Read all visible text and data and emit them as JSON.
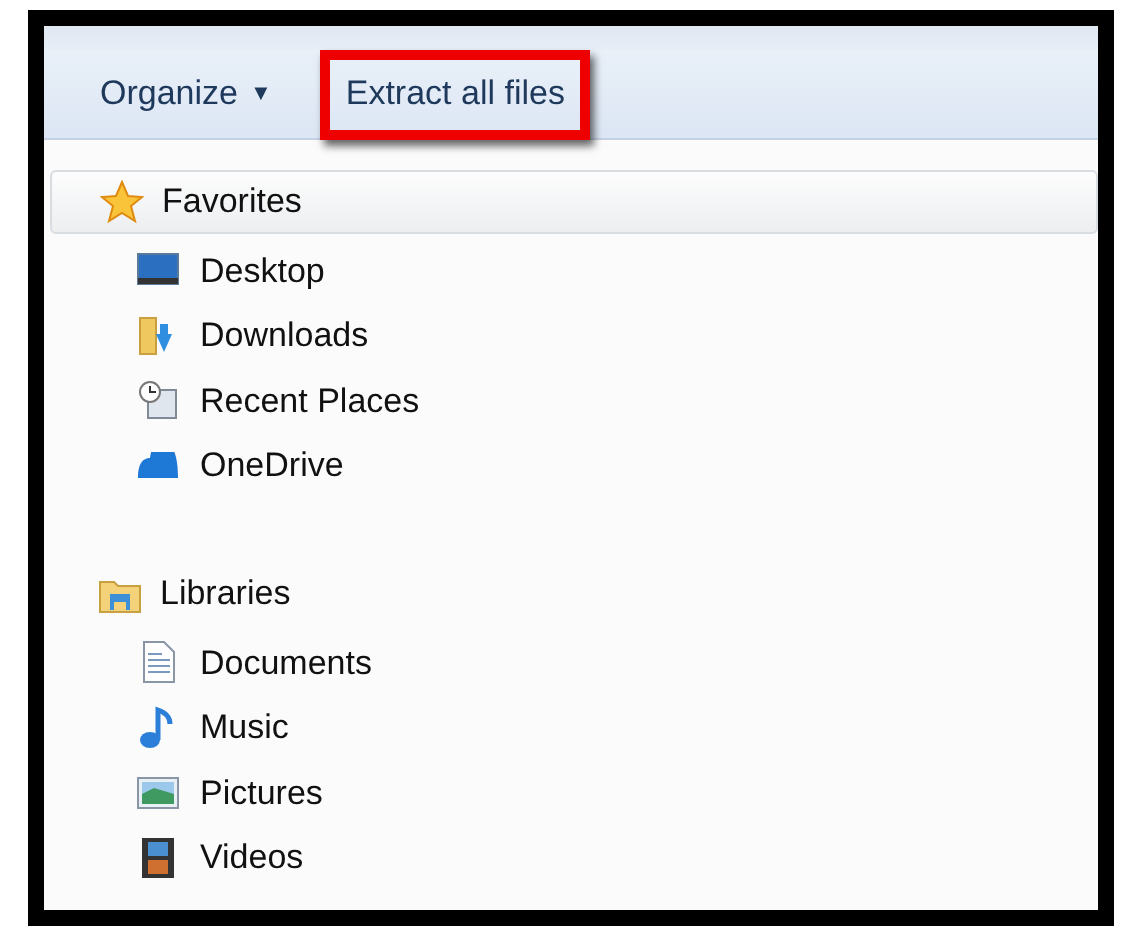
{
  "toolbar": {
    "organize": {
      "label": "Organize",
      "caret": "▼"
    },
    "extract_button": {
      "label": "Extract all files",
      "highlighted": true
    }
  },
  "navigation": [
    {
      "label": "Favorites",
      "header_bar": true,
      "items": [
        {
          "label": "Desktop"
        },
        {
          "label": "Downloads"
        },
        {
          "label": "Recent Places"
        },
        {
          "label": "OneDrive"
        }
      ]
    },
    {
      "label": "Libraries",
      "header_bar": false,
      "items": [
        {
          "label": "Documents"
        },
        {
          "label": "Music"
        },
        {
          "label": "Pictures"
        },
        {
          "label": "Videos"
        }
      ]
    }
  ]
}
